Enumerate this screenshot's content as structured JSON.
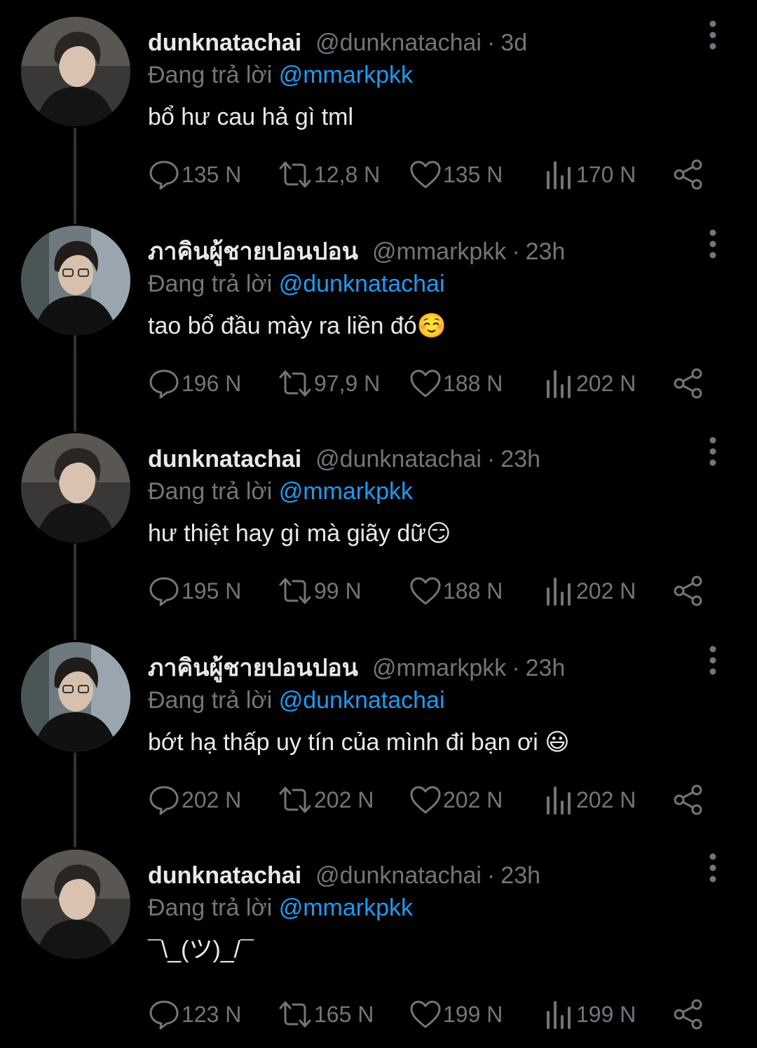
{
  "tweets": [
    {
      "display_name": "dunknatachai",
      "handle": "@dunknatachai",
      "dot": "·",
      "time": "3d",
      "reply_prefix": "Đang trả lời",
      "reply_to": "@mmarkpkk",
      "text": "bổ hư cau hả gì tml",
      "replies": "135 N",
      "retweets": "12,8 N",
      "likes": "135 N",
      "views": "170 N"
    },
    {
      "display_name": "ภาคินผู้ชายปอนปอน",
      "handle": "@mmarkpkk",
      "dot": "·",
      "time": "23h",
      "reply_prefix": "Đang trả lời",
      "reply_to": "@dunknatachai",
      "text": "tao bổ đầu mày ra liền đó☺️",
      "replies": "196 N",
      "retweets": "97,9 N",
      "likes": "188 N",
      "views": "202 N"
    },
    {
      "display_name": "dunknatachai",
      "handle": "@dunknatachai",
      "dot": "·",
      "time": "23h",
      "reply_prefix": "Đang trả lời",
      "reply_to": "@mmarkpkk",
      "text": "hư thiệt hay gì mà giãy dữ😏",
      "replies": "195 N",
      "retweets": "99 N",
      "likes": "188 N",
      "views": "202 N"
    },
    {
      "display_name": "ภาคินผู้ชายปอนปอน",
      "handle": "@mmarkpkk",
      "dot": "·",
      "time": "23h",
      "reply_prefix": "Đang trả lời",
      "reply_to": "@dunknatachai",
      "text": "bớt hạ thấp uy tín của mình đi bạn ơi 😃",
      "replies": "202 N",
      "retweets": "202 N",
      "likes": "202 N",
      "views": "202 N"
    },
    {
      "display_name": "dunknatachai",
      "handle": "@dunknatachai",
      "dot": "·",
      "time": "23h",
      "reply_prefix": "Đang trả lời",
      "reply_to": "@mmarkpkk",
      "text": "¯\\_(ツ)_/¯",
      "replies": "123 N",
      "retweets": "165 N",
      "likes": "199 N",
      "views": "199 N"
    }
  ],
  "colors": {
    "background": "#000000",
    "primary_text": "#e7e9ea",
    "secondary_text": "#71767b",
    "link": "#1d9bf0",
    "thread_line": "#2f3336"
  },
  "icons": {
    "reply": "speech-bubble-icon",
    "retweet": "retweet-icon",
    "like": "heart-icon",
    "views": "bar-chart-icon",
    "share": "share-icon",
    "more": "vertical-dots-icon"
  }
}
